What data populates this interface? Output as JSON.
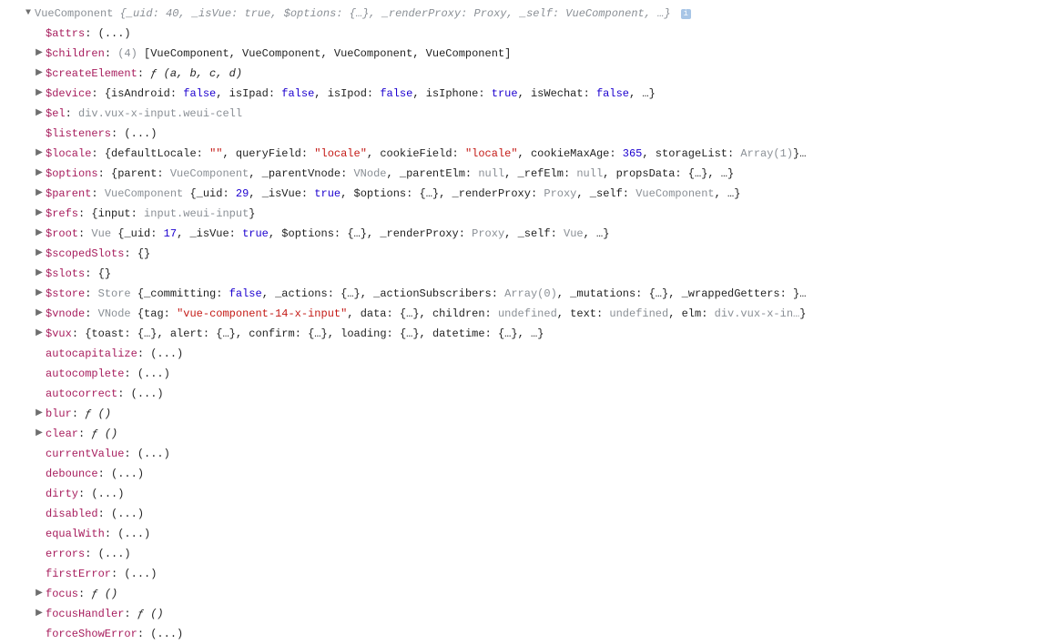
{
  "header": {
    "constructor": "VueComponent",
    "preview": "{_uid: 40, _isVue: true, $options: {…}, _renderProxy: Proxy, _self: VueComponent, …}",
    "badge": "i"
  },
  "props": [
    {
      "key": "$attrs",
      "arrow": false,
      "raw": "(...)"
    },
    {
      "key": "$children",
      "arrow": true,
      "count": "(4)",
      "raw_array": "[VueComponent, VueComponent, VueComponent, VueComponent]"
    },
    {
      "key": "$createElement",
      "arrow": true,
      "fn": "ƒ (a, b, c, d)"
    },
    {
      "key": "$device",
      "arrow": true,
      "obj": [
        {
          "k": "isAndroid",
          "t": "bool",
          "v": "false"
        },
        {
          "k": "isIpad",
          "t": "bool",
          "v": "false"
        },
        {
          "k": "isIpod",
          "t": "bool",
          "v": "false"
        },
        {
          "k": "isIphone",
          "t": "bool",
          "v": "true"
        },
        {
          "k": "isWechat",
          "t": "bool",
          "v": "false"
        }
      ],
      "ellipsis": true
    },
    {
      "key": "$el",
      "arrow": true,
      "dim": "div.vux-x-input.weui-cell"
    },
    {
      "key": "$listeners",
      "arrow": false,
      "raw": "(...)"
    },
    {
      "key": "$locale",
      "arrow": true,
      "obj": [
        {
          "k": "defaultLocale",
          "t": "str",
          "v": "\"\""
        },
        {
          "k": "queryField",
          "t": "str",
          "v": "\"locale\""
        },
        {
          "k": "cookieField",
          "t": "str",
          "v": "\"locale\""
        },
        {
          "k": "cookieMaxAge",
          "t": "num",
          "v": "365"
        },
        {
          "k": "storageList",
          "t": "dim",
          "v": "Array(1)"
        }
      ],
      "trail": "…"
    },
    {
      "key": "$options",
      "arrow": true,
      "obj": [
        {
          "k": "parent",
          "t": "dim",
          "v": "VueComponent"
        },
        {
          "k": "_parentVnode",
          "t": "dim",
          "v": "VNode"
        },
        {
          "k": "_parentElm",
          "t": "dim",
          "v": "null"
        },
        {
          "k": "_refElm",
          "t": "dim",
          "v": "null"
        },
        {
          "k": "propsData",
          "t": "raw",
          "v": "{…}"
        }
      ],
      "ellipsis": true
    },
    {
      "key": "$parent",
      "arrow": true,
      "dimprefix": "VueComponent",
      "obj": [
        {
          "k": "_uid",
          "t": "num",
          "v": "29"
        },
        {
          "k": "_isVue",
          "t": "bool",
          "v": "true"
        },
        {
          "k": "$options",
          "t": "raw",
          "v": "{…}"
        },
        {
          "k": "_renderProxy",
          "t": "dim",
          "v": "Proxy"
        },
        {
          "k": "_self",
          "t": "dim",
          "v": "VueComponent"
        }
      ],
      "ellipsis": true
    },
    {
      "key": "$refs",
      "arrow": true,
      "obj": [
        {
          "k": "input",
          "t": "dim",
          "v": "input.weui-input"
        }
      ]
    },
    {
      "key": "$root",
      "arrow": true,
      "dimprefix": "Vue",
      "obj": [
        {
          "k": "_uid",
          "t": "num",
          "v": "17"
        },
        {
          "k": "_isVue",
          "t": "bool",
          "v": "true"
        },
        {
          "k": "$options",
          "t": "raw",
          "v": "{…}"
        },
        {
          "k": "_renderProxy",
          "t": "dim",
          "v": "Proxy"
        },
        {
          "k": "_self",
          "t": "dim",
          "v": "Vue"
        }
      ],
      "ellipsis": true
    },
    {
      "key": "$scopedSlots",
      "arrow": true,
      "raw": "{}"
    },
    {
      "key": "$slots",
      "arrow": true,
      "raw": "{}"
    },
    {
      "key": "$store",
      "arrow": true,
      "dimprefix": "Store",
      "obj": [
        {
          "k": "_committing",
          "t": "bool",
          "v": "false"
        },
        {
          "k": "_actions",
          "t": "raw",
          "v": "{…}"
        },
        {
          "k": "_actionSubscribers",
          "t": "dim",
          "v": "Array(0)"
        },
        {
          "k": "_mutations",
          "t": "raw",
          "v": "{…}"
        },
        {
          "k": "_wrappedGetters",
          "t": "raw",
          "v": ""
        }
      ],
      "trail": "…"
    },
    {
      "key": "$vnode",
      "arrow": true,
      "dimprefix": "VNode",
      "obj": [
        {
          "k": "tag",
          "t": "str",
          "v": "\"vue-component-14-x-input\""
        },
        {
          "k": "data",
          "t": "raw",
          "v": "{…}"
        },
        {
          "k": "children",
          "t": "dim",
          "v": "undefined"
        },
        {
          "k": "text",
          "t": "dim",
          "v": "undefined"
        },
        {
          "k": "elm",
          "t": "dim",
          "v": "div.vux-x-in…"
        }
      ]
    },
    {
      "key": "$vux",
      "arrow": true,
      "obj": [
        {
          "k": "toast",
          "t": "raw",
          "v": "{…}"
        },
        {
          "k": "alert",
          "t": "raw",
          "v": "{…}"
        },
        {
          "k": "confirm",
          "t": "raw",
          "v": "{…}"
        },
        {
          "k": "loading",
          "t": "raw",
          "v": "{…}"
        },
        {
          "k": "datetime",
          "t": "raw",
          "v": "{…}"
        }
      ],
      "ellipsis": true
    },
    {
      "key": "autocapitalize",
      "arrow": false,
      "raw": "(...)"
    },
    {
      "key": "autocomplete",
      "arrow": false,
      "raw": "(...)"
    },
    {
      "key": "autocorrect",
      "arrow": false,
      "raw": "(...)"
    },
    {
      "key": "blur",
      "arrow": true,
      "fn": "ƒ ()"
    },
    {
      "key": "clear",
      "arrow": true,
      "fn": "ƒ ()"
    },
    {
      "key": "currentValue",
      "arrow": false,
      "raw": "(...)"
    },
    {
      "key": "debounce",
      "arrow": false,
      "raw": "(...)"
    },
    {
      "key": "dirty",
      "arrow": false,
      "raw": "(...)"
    },
    {
      "key": "disabled",
      "arrow": false,
      "raw": "(...)"
    },
    {
      "key": "equalWith",
      "arrow": false,
      "raw": "(...)"
    },
    {
      "key": "errors",
      "arrow": false,
      "raw": "(...)"
    },
    {
      "key": "firstError",
      "arrow": false,
      "raw": "(...)"
    },
    {
      "key": "focus",
      "arrow": true,
      "fn": "ƒ ()"
    },
    {
      "key": "focusHandler",
      "arrow": true,
      "fn": "ƒ ()"
    },
    {
      "key": "forceShowError",
      "arrow": false,
      "raw": "(...)"
    }
  ]
}
